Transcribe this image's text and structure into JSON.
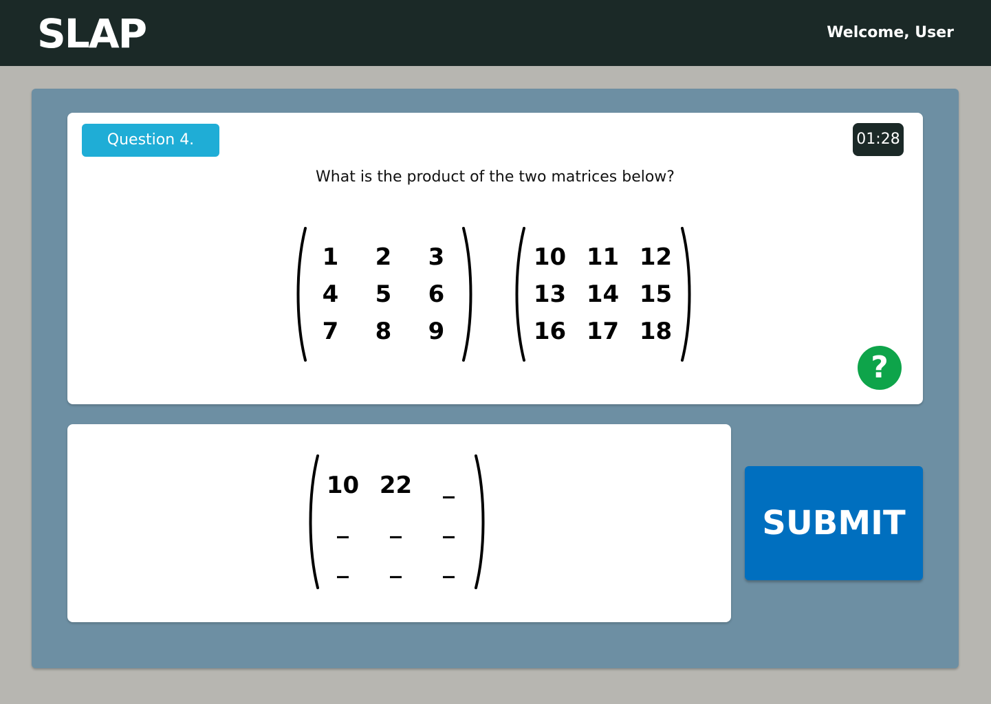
{
  "header": {
    "logo": "SLAP",
    "welcome": "Welcome, User"
  },
  "question": {
    "badge": "Question 4.",
    "timer": "01:28",
    "text": "What is the product of the two matrices below?",
    "matrix_a": [
      [
        "1",
        "2",
        "3"
      ],
      [
        "4",
        "5",
        "6"
      ],
      [
        "7",
        "8",
        "9"
      ]
    ],
    "matrix_b": [
      [
        "10",
        "11",
        "12"
      ],
      [
        "13",
        "14",
        "15"
      ],
      [
        "16",
        "17",
        "18"
      ]
    ],
    "help_label": "?"
  },
  "answer": {
    "cells": [
      {
        "value": "10",
        "placeholder": "_"
      },
      {
        "value": "22",
        "placeholder": "_"
      },
      {
        "value": "",
        "placeholder": "_"
      },
      {
        "value": "",
        "placeholder": "_"
      },
      {
        "value": "",
        "placeholder": "_"
      },
      {
        "value": "",
        "placeholder": "_"
      },
      {
        "value": "",
        "placeholder": "_"
      },
      {
        "value": "",
        "placeholder": "_"
      },
      {
        "value": "",
        "placeholder": "_"
      }
    ]
  },
  "actions": {
    "submit_label": "SUBMIT"
  },
  "colors": {
    "topbar": "#1b2927",
    "panel": "#6d8fa3",
    "badge": "#1fadd6",
    "help": "#0ea44a",
    "submit": "#006fbf"
  }
}
